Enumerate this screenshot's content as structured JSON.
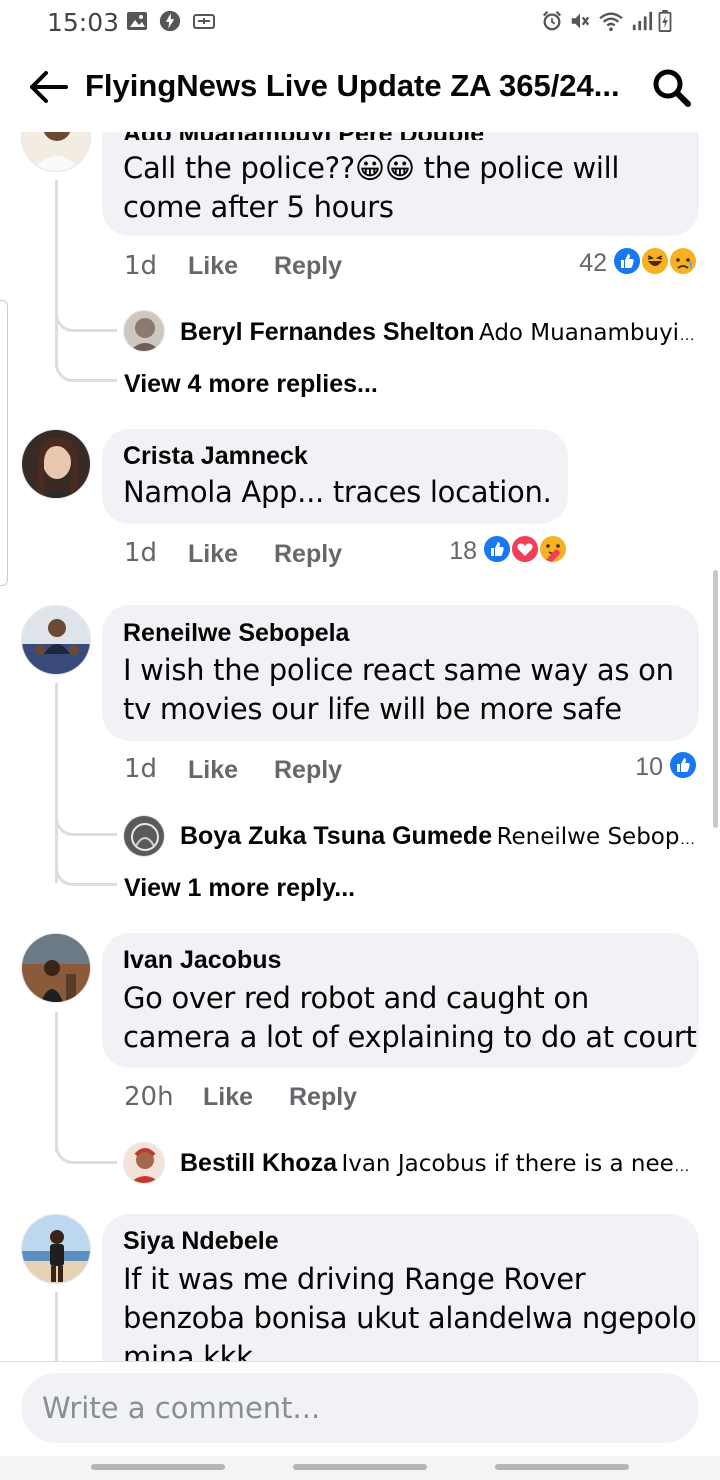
{
  "status_bar": {
    "time": "15:03",
    "left_icons": [
      "image-icon",
      "messenger-icon",
      "download-box-icon"
    ],
    "right_icons": [
      "alarm-icon",
      "mute-icon",
      "wifi-icon",
      "signal-icon",
      "battery-charging-icon"
    ]
  },
  "header": {
    "title": "FlyingNews Live Update ZA 365/24...",
    "back_icon": "back-arrow-icon",
    "search_icon": "search-icon"
  },
  "comments": [
    {
      "author": "Ado Muanambuyi Pere Double",
      "text_lines": [
        "Call the police??😀😀 the police will",
        "come after 5 hours"
      ],
      "time": "1d",
      "like_label": "Like",
      "reply_label": "Reply",
      "reaction_count": "42",
      "reactions": [
        "like",
        "haha",
        "sad"
      ],
      "reply_preview": {
        "name": "Beryl Fernandes Shelton",
        "text": "Ado Muanambuyi..."
      },
      "view_more": "View 4 more replies..."
    },
    {
      "author": "Crista Jamneck",
      "text_lines": [
        "Namola App... traces location."
      ],
      "time": "1d",
      "like_label": "Like",
      "reply_label": "Reply",
      "reaction_count": "18",
      "reactions": [
        "like",
        "love",
        "care"
      ]
    },
    {
      "author": "Reneilwe Sebopela",
      "text_lines": [
        "I wish the police react same way as on",
        "tv movies our life will be more safe"
      ],
      "time": "1d",
      "like_label": "Like",
      "reply_label": "Reply",
      "reaction_count": "10",
      "reactions": [
        "like"
      ],
      "reply_preview": {
        "name": "Boya Zuka Tsuna Gumede",
        "text": "Reneilwe Sebop..."
      },
      "view_more": "View 1 more reply..."
    },
    {
      "author": "Ivan Jacobus",
      "text_lines": [
        "Go over red robot and caught on",
        "camera a lot of explaining to do at court"
      ],
      "time": "20h",
      "like_label": "Like",
      "reply_label": "Reply",
      "reply_preview": {
        "name": "Bestill Khoza",
        "text": "Ivan Jacobus if there is a need..."
      }
    },
    {
      "author": "Siya Ndebele",
      "text_lines": [
        "If it was me driving Range Rover",
        "benzoba bonisa ukut alandelwa ngepolo",
        "mina kkk"
      ]
    }
  ],
  "composer": {
    "placeholder": "Write a comment..."
  },
  "colors": {
    "bubble": "#f0f2f5",
    "meta_gray": "#65676b",
    "like_blue": "#1877f2",
    "love_red": "#f33e58",
    "emoji_yellow": "#f7b125"
  }
}
